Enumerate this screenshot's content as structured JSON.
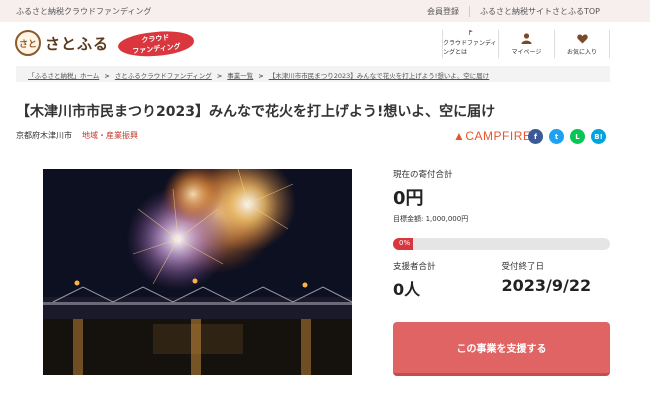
{
  "topbar": {
    "tagline": "ふるさと納税クラウドファンディング",
    "links": [
      "会員登録",
      "ふるさと納税サイトさとふるTOP"
    ]
  },
  "header": {
    "logo_text": "さとふる",
    "logo_mark": "さと",
    "badge_line1": "クラウド",
    "badge_line2": "ファンディング",
    "nav": [
      {
        "label": "クラウドファンディングとは",
        "icon": "flag-icon"
      },
      {
        "label": "マイページ",
        "icon": "person-icon"
      },
      {
        "label": "お気に入り",
        "icon": "heart-icon"
      }
    ]
  },
  "breadcrumb": [
    "「ふるさと納税」ホーム",
    "さとふるクラウドファンディング",
    "事業一覧",
    "【木津川市市民まつり2023】みんなで花火を打上げよう!想いよ、空に届け"
  ],
  "project": {
    "title": "【木津川市市民まつり2023】みんなで花火を打上げよう!想いよ、空に届け",
    "location": "京都府木津川市",
    "category": "地域・産業振興",
    "platform": "CAMPFIRE"
  },
  "share": [
    {
      "name": "facebook",
      "glyph": "f",
      "color": "#3b5998"
    },
    {
      "name": "twitter",
      "glyph": "t",
      "color": "#1da1f2"
    },
    {
      "name": "line",
      "glyph": "L",
      "color": "#06c755"
    },
    {
      "name": "hatena",
      "glyph": "B!",
      "color": "#00a4de"
    }
  ],
  "stats": {
    "current_label": "現在の寄付合計",
    "current_amount": "0円",
    "goal_label": "目標金額: 1,000,000円",
    "progress_text": "0%",
    "progress_value": 0,
    "supporters_label": "支援者合計",
    "supporters_value": "0人",
    "deadline_label": "受付終了日",
    "deadline_value": "2023/9/22"
  },
  "cta": {
    "label": "この事業を支援する"
  },
  "colors": {
    "accent": "#d9363e",
    "button": "#e06464",
    "topbar": "#f7eeee"
  }
}
